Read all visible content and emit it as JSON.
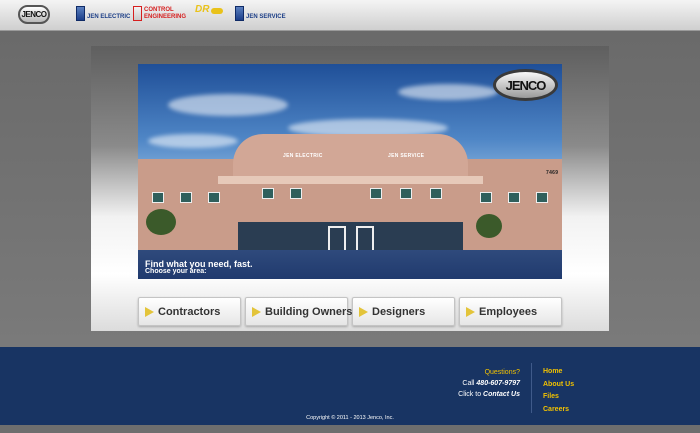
{
  "header": {
    "logos": [
      {
        "name": "Jenco",
        "text": "JENCO"
      },
      {
        "name": "Jen Electric",
        "text": "JEN ELECTRIC",
        "color": "#1a3d86"
      },
      {
        "name": "Control Engineering",
        "text": "CONTROL ENGINEERING",
        "color": "#d61e1e"
      },
      {
        "name": "DR Design",
        "text": "DR",
        "color": "#e9c21a"
      },
      {
        "name": "Jen Service",
        "text": "JEN SERVICE",
        "color": "#1a3d86"
      }
    ]
  },
  "hero": {
    "logo_text": "JENCO",
    "headline": "Find what you need, fast.",
    "subline": "Choose your area:",
    "sign_left": "JEN ELECTRIC",
    "sign_right": "JEN SERVICE",
    "address": "7469"
  },
  "categories": [
    {
      "label": "Contractors"
    },
    {
      "label": "Building Owners"
    },
    {
      "label": "Designers"
    },
    {
      "label": "Employees"
    }
  ],
  "footer": {
    "questions": "Questions?",
    "call_prefix": "Call ",
    "phone": "480-607-9797",
    "click_prefix": "Click to ",
    "contact_link": "Contact Us",
    "nav": [
      "Home",
      "About Us",
      "Files",
      "Careers"
    ],
    "copyright": "Copyright © 2011 - 2013 Jenco, Inc."
  },
  "colors": {
    "footer_bg": "#183463",
    "accent_yellow": "#f2c200"
  }
}
